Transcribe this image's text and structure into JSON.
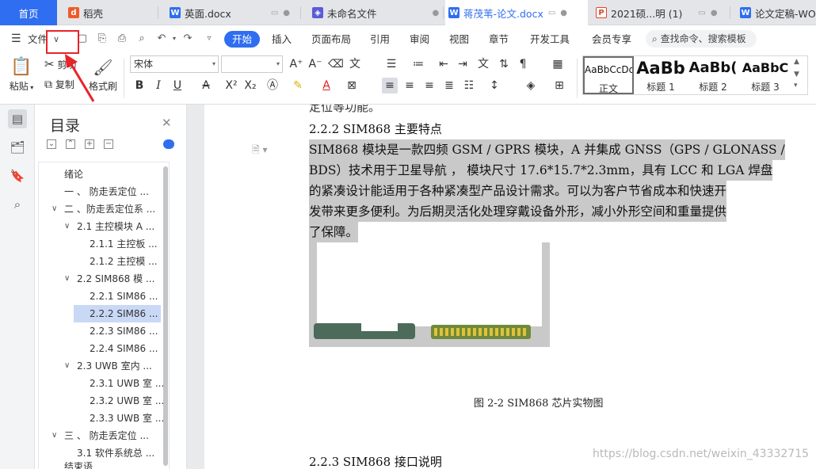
{
  "tabs": [
    {
      "label": "首页"
    },
    {
      "label": "稻壳"
    },
    {
      "label": "英面.docx"
    },
    {
      "label": "未命名文件"
    },
    {
      "label": "蒋茂苇-论文.docx"
    },
    {
      "label": "2021硕...明 (1)"
    },
    {
      "label": "论文定稿-WOR"
    }
  ],
  "menu": {
    "file": "文件",
    "items": [
      "开始",
      "插入",
      "页面布局",
      "引用",
      "审阅",
      "视图",
      "章节",
      "开发工具",
      "会员专享"
    ],
    "search": "查找命令、搜索模板"
  },
  "toolbar": {
    "paste": "粘贴",
    "cut": "剪切",
    "copy": "复制",
    "format_painter": "格式刷",
    "font_name": "宋体",
    "font_size": ""
  },
  "styles": [
    {
      "preview": "AaBbCcDd",
      "label": "正文"
    },
    {
      "preview": "AaBb",
      "label": "标题 1"
    },
    {
      "preview": "AaBb(",
      "label": "标题 2"
    },
    {
      "preview": "AaBbC",
      "label": "标题 3"
    }
  ],
  "toc": {
    "title": "目录",
    "items": [
      {
        "label": "绪论"
      },
      {
        "label": "一 、 防走丢定位 ..."
      },
      {
        "label": "二 、防走丢定位系 ..."
      },
      {
        "label": "2.1 主控模块 A ..."
      },
      {
        "label": "2.1.1 主控板 ..."
      },
      {
        "label": "2.1.2 主控模 ..."
      },
      {
        "label": "2.2 SIM868 模 ..."
      },
      {
        "label": "2.2.1 SIM86 ..."
      },
      {
        "label": "2.2.2 SIM86 ..."
      },
      {
        "label": "2.2.3 SIM86 ..."
      },
      {
        "label": "2.2.4 SIM86 ..."
      },
      {
        "label": "2.3 UWB 室内 ..."
      },
      {
        "label": "2.3.1 UWB 室 ..."
      },
      {
        "label": "2.3.2 UWB 室 ..."
      },
      {
        "label": "2.3.3 UWB 室 ..."
      },
      {
        "label": "三 、 防走丢定位 ..."
      },
      {
        "label": "3.1 软件系统总 ..."
      },
      {
        "label": "结束语"
      }
    ]
  },
  "document": {
    "cut_line": "定位等功能。",
    "heading_222": "2.2.2 SIM868 主要特点",
    "para_lines": [
      "  SIM868 模块是一款四频 GSM / GPRS 模块，A 并集成 GNSS（GPS / GLONASS /",
      "BDS）技术用于卫星导航 ，  模块尺寸 17.6*15.7*2.3mm，具有 LCC 和 LGA 焊盘",
      "的紧凑设计能适用于各种紧凑型产品设计需求。可以为客户节省成本和快速开",
      "发带来更多便利。为后期灵活化处理穿戴设备外形，减小外形空间和重量提供",
      "了保障。"
    ],
    "caption": "图 2-2   SIM868 芯片实物图",
    "heading_223": "2.2.3 SIM868 接口说明"
  },
  "watermark": "https://blog.csdn.net/weixin_43332715",
  "colors": {
    "accent": "#2f6ef0",
    "highlight": "#e8232a",
    "selection": "#c9c9c9"
  }
}
